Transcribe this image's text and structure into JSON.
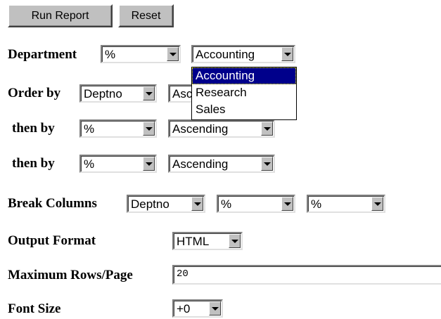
{
  "buttons": {
    "run_report": "Run Report",
    "reset": "Reset"
  },
  "department": {
    "label": "Department",
    "filter_value": "%",
    "select_value": "Accounting",
    "options": [
      "Accounting",
      "Research",
      "Sales"
    ],
    "highlighted_option": "Accounting"
  },
  "order_by": {
    "label": "Order by",
    "column": "Deptno",
    "direction": "Ascending"
  },
  "then_by_1": {
    "label": "then by",
    "column": "%",
    "direction": "Ascending"
  },
  "then_by_2": {
    "label": "then by",
    "column": "%",
    "direction": "Ascending"
  },
  "break_columns": {
    "label": "Break Columns",
    "col1": "Deptno",
    "col2": "%",
    "col3": "%"
  },
  "output_format": {
    "label": "Output Format",
    "value": "HTML"
  },
  "max_rows": {
    "label": "Maximum Rows/Page",
    "value": "20"
  },
  "font_size": {
    "label": "Font Size",
    "value": "+0"
  },
  "icons": {
    "dropdown_arrow": "chevron-down-icon"
  },
  "colors": {
    "highlight": "#00008b",
    "button_face": "#c0c0c0"
  }
}
